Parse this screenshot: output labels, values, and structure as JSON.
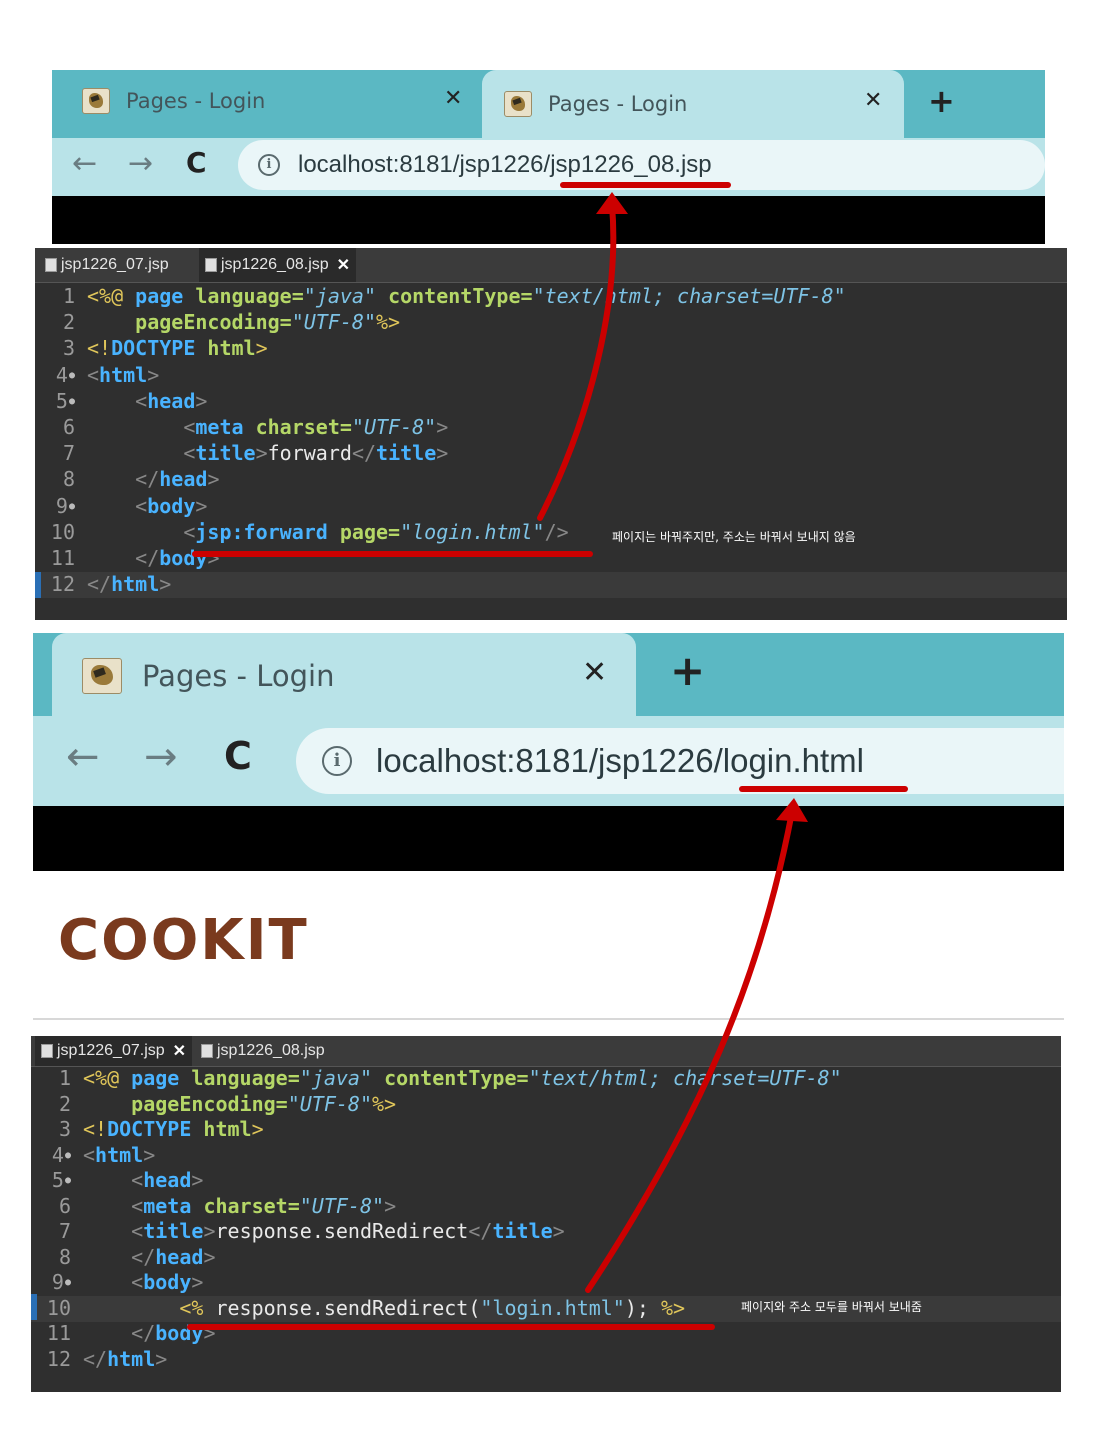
{
  "top_browser": {
    "tabs": [
      {
        "label": "Pages - Login",
        "close": "✕"
      },
      {
        "label": "Pages - Login",
        "close": "✕"
      }
    ],
    "new_tab": "+",
    "nav": {
      "back": "←",
      "forward": "→",
      "reload": "C"
    },
    "info": "i",
    "url": "localhost:8181/jsp1226/jsp1226_08.jsp"
  },
  "top_editor": {
    "tabs": [
      {
        "label": "jsp1226_07.jsp"
      },
      {
        "label": "jsp1226_08.jsp",
        "close": "✕"
      }
    ],
    "line_numbers": [
      "1",
      "2",
      "3",
      "4",
      "5",
      "6",
      "7",
      "8",
      "9",
      "10",
      "11",
      "12"
    ],
    "annotation": "페이지는 바꿔주지만, 주소는 바꿔서 보내지 않음",
    "lines": [
      [
        [
          "kw",
          "<%@ "
        ],
        [
          "tag",
          "page "
        ],
        [
          "attr",
          "language="
        ],
        [
          "str",
          "\"java\" "
        ],
        [
          "attr",
          "contentType="
        ],
        [
          "str",
          "\"text/html; charset=UTF-8\""
        ]
      ],
      [
        [
          "plain",
          "    "
        ],
        [
          "attr",
          "pageEncoding="
        ],
        [
          "str",
          "\"UTF-8\""
        ],
        [
          "kw",
          "%>"
        ]
      ],
      [
        [
          "kw",
          "<!"
        ],
        [
          "tag",
          "DOCTYPE "
        ],
        [
          "attr",
          "html"
        ],
        [
          "kw",
          ">"
        ]
      ],
      [
        [
          "br",
          "<"
        ],
        [
          "tag",
          "html"
        ],
        [
          "br",
          ">"
        ]
      ],
      [
        [
          "plain",
          "    "
        ],
        [
          "br",
          "<"
        ],
        [
          "tag",
          "head"
        ],
        [
          "br",
          ">"
        ]
      ],
      [
        [
          "plain",
          "        "
        ],
        [
          "br",
          "<"
        ],
        [
          "tag",
          "meta "
        ],
        [
          "attr",
          "charset="
        ],
        [
          "str",
          "\"UTF-8\""
        ],
        [
          "br",
          ">"
        ]
      ],
      [
        [
          "plain",
          "        "
        ],
        [
          "br",
          "<"
        ],
        [
          "tag",
          "title"
        ],
        [
          "br",
          ">"
        ],
        [
          "plain",
          "forward"
        ],
        [
          "br",
          "</"
        ],
        [
          "tag",
          "title"
        ],
        [
          "br",
          ">"
        ]
      ],
      [
        [
          "plain",
          "    "
        ],
        [
          "br",
          "</"
        ],
        [
          "tag",
          "head"
        ],
        [
          "br",
          ">"
        ]
      ],
      [
        [
          "plain",
          "    "
        ],
        [
          "br",
          "<"
        ],
        [
          "tag",
          "body"
        ],
        [
          "br",
          ">"
        ]
      ],
      [
        [
          "plain",
          "        "
        ],
        [
          "br",
          "<"
        ],
        [
          "tag",
          "jsp:forward "
        ],
        [
          "attr",
          "page="
        ],
        [
          "str",
          "\"login.html\""
        ],
        [
          "br",
          "/>"
        ]
      ],
      [
        [
          "plain",
          "    "
        ],
        [
          "br",
          "</"
        ],
        [
          "tag",
          "body"
        ],
        [
          "br",
          ">"
        ]
      ],
      [
        [
          "br",
          "</"
        ],
        [
          "tag",
          "html"
        ],
        [
          "br",
          ">"
        ]
      ]
    ]
  },
  "bottom_browser": {
    "tabs": [
      {
        "label": "Pages - Login",
        "close": "✕"
      }
    ],
    "new_tab": "+",
    "nav": {
      "back": "←",
      "forward": "→",
      "reload": "C"
    },
    "info": "i",
    "url": "localhost:8181/jsp1226/login.html"
  },
  "logo": "COOKIT",
  "bottom_editor": {
    "tabs": [
      {
        "label": "jsp1226_07.jsp",
        "close": "✕"
      },
      {
        "label": "jsp1226_08.jsp"
      }
    ],
    "line_numbers": [
      "1",
      "2",
      "3",
      "4",
      "5",
      "6",
      "7",
      "8",
      "9",
      "10",
      "11",
      "12"
    ],
    "annotation": "페이지와 주소 모두를 바꿔서 보내줌",
    "lines": [
      [
        [
          "kw",
          "<%@ "
        ],
        [
          "tag",
          "page "
        ],
        [
          "attr",
          "language="
        ],
        [
          "str",
          "\"java\" "
        ],
        [
          "attr",
          "contentType="
        ],
        [
          "str",
          "\"text/html; charset=UTF-8\""
        ]
      ],
      [
        [
          "plain",
          "    "
        ],
        [
          "attr",
          "pageEncoding="
        ],
        [
          "str",
          "\"UTF-8\""
        ],
        [
          "kw",
          "%>"
        ]
      ],
      [
        [
          "kw",
          "<!"
        ],
        [
          "tag",
          "DOCTYPE "
        ],
        [
          "attr",
          "html"
        ],
        [
          "kw",
          ">"
        ]
      ],
      [
        [
          "br",
          "<"
        ],
        [
          "tag",
          "html"
        ],
        [
          "br",
          ">"
        ]
      ],
      [
        [
          "plain",
          "    "
        ],
        [
          "br",
          "<"
        ],
        [
          "tag",
          "head"
        ],
        [
          "br",
          ">"
        ]
      ],
      [
        [
          "plain",
          "    "
        ],
        [
          "br",
          "<"
        ],
        [
          "tag",
          "meta "
        ],
        [
          "attr",
          "charset="
        ],
        [
          "str",
          "\"UTF-8\""
        ],
        [
          "br",
          ">"
        ]
      ],
      [
        [
          "plain",
          "    "
        ],
        [
          "br",
          "<"
        ],
        [
          "tag",
          "title"
        ],
        [
          "br",
          ">"
        ],
        [
          "plain",
          "response.sendRedirect"
        ],
        [
          "br",
          "</"
        ],
        [
          "tag",
          "title"
        ],
        [
          "br",
          ">"
        ]
      ],
      [
        [
          "plain",
          "    "
        ],
        [
          "br",
          "</"
        ],
        [
          "tag",
          "head"
        ],
        [
          "br",
          ">"
        ]
      ],
      [
        [
          "plain",
          "    "
        ],
        [
          "br",
          "<"
        ],
        [
          "tag",
          "body"
        ],
        [
          "br",
          ">"
        ]
      ],
      [
        [
          "plain",
          "        "
        ],
        [
          "kw",
          "<% "
        ],
        [
          "plain",
          "response.sendRedirect("
        ],
        [
          "strn",
          "\"login.html\""
        ],
        [
          "plain",
          "); "
        ],
        [
          "kw",
          "%>"
        ]
      ],
      [
        [
          "plain",
          "    "
        ],
        [
          "br",
          "</"
        ],
        [
          "tag",
          "body"
        ],
        [
          "br",
          ">"
        ]
      ],
      [
        [
          "br",
          "</"
        ],
        [
          "tag",
          "html"
        ],
        [
          "br",
          ">"
        ]
      ]
    ]
  },
  "colors": {
    "annotation_red": "#cc0000",
    "tab_bar": "#5bb8c3",
    "tab_active": "#b9e3e8",
    "editor_bg": "#2f2f2f"
  }
}
